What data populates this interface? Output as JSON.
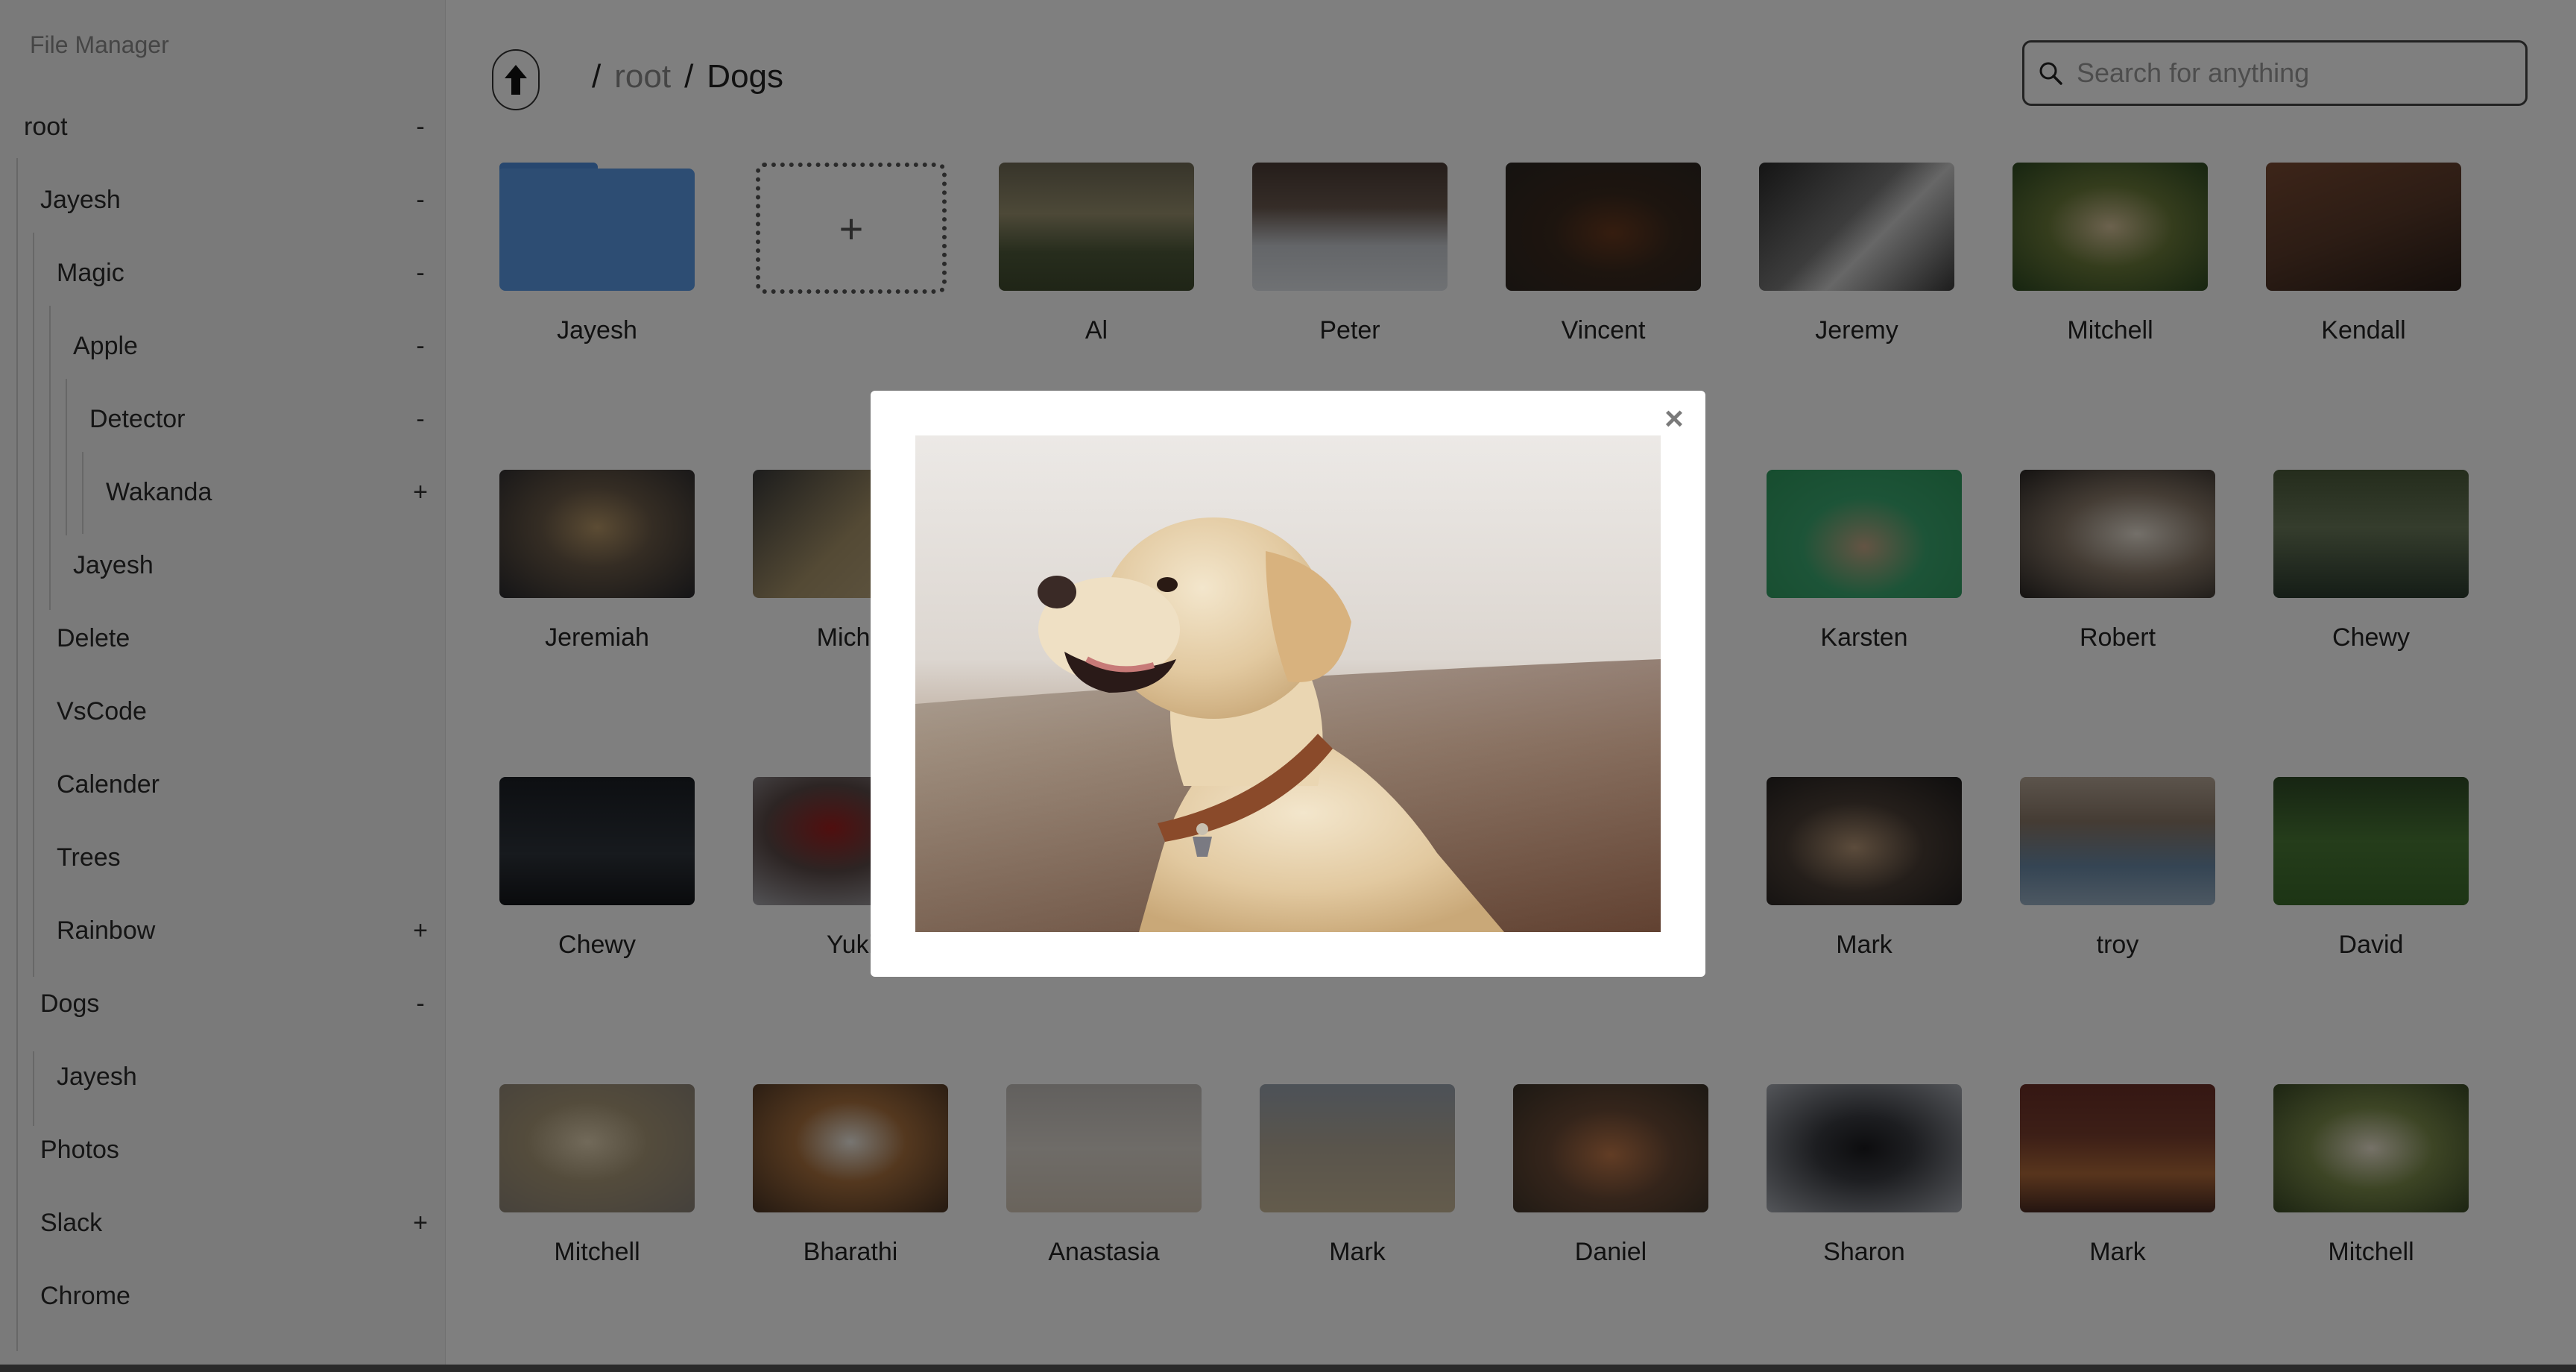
{
  "sidebar": {
    "title": "File Manager",
    "items": [
      {
        "label": "root",
        "toggle": "-"
      },
      {
        "label": "Jayesh",
        "toggle": "-"
      },
      {
        "label": "Magic",
        "toggle": "-"
      },
      {
        "label": "Apple",
        "toggle": "-"
      },
      {
        "label": "Detector",
        "toggle": "-"
      },
      {
        "label": "Wakanda",
        "toggle": "+"
      },
      {
        "label": "Jayesh",
        "toggle": ""
      },
      {
        "label": "Delete",
        "toggle": ""
      },
      {
        "label": "VsCode",
        "toggle": ""
      },
      {
        "label": "Calender",
        "toggle": ""
      },
      {
        "label": "Trees",
        "toggle": ""
      },
      {
        "label": "Rainbow",
        "toggle": "+"
      },
      {
        "label": "Dogs",
        "toggle": "-"
      },
      {
        "label": "Jayesh",
        "toggle": ""
      },
      {
        "label": "Photos",
        "toggle": ""
      },
      {
        "label": "Slack",
        "toggle": "+"
      },
      {
        "label": "Chrome",
        "toggle": ""
      }
    ]
  },
  "breadcrumb": {
    "sep": "/",
    "root": "root",
    "current": "Dogs"
  },
  "search": {
    "placeholder": "Search for anything"
  },
  "grid": {
    "row1": [
      {
        "label": "Jayesh",
        "kind": "folder"
      },
      {
        "label": "",
        "kind": "add",
        "symbol": "+"
      },
      {
        "label": "Al"
      },
      {
        "label": "Peter"
      },
      {
        "label": "Vincent"
      },
      {
        "label": "Jeremy"
      },
      {
        "label": "Mitchell"
      },
      {
        "label": "Kendall"
      }
    ],
    "row2": [
      {
        "label": "Jeremiah"
      },
      {
        "label": "Micha"
      },
      {
        "label": "Karsten"
      },
      {
        "label": "Robert"
      },
      {
        "label": "Chewy"
      }
    ],
    "row3": [
      {
        "label": "Chewy"
      },
      {
        "label": "Yuki"
      },
      {
        "label": "Mark"
      },
      {
        "label": "troy"
      },
      {
        "label": "David"
      }
    ],
    "row4": [
      {
        "label": "Mitchell"
      },
      {
        "label": "Bharathi"
      },
      {
        "label": "Anastasia"
      },
      {
        "label": "Mark"
      },
      {
        "label": "Daniel"
      },
      {
        "label": "Sharon"
      },
      {
        "label": "Mark"
      },
      {
        "label": "Mitchell"
      }
    ]
  },
  "modal": {
    "close": "×",
    "image": "labrador-portrait"
  },
  "colors": {
    "folder": "#5a9ae6",
    "overlay": "rgba(0,0,0,0.5)"
  }
}
